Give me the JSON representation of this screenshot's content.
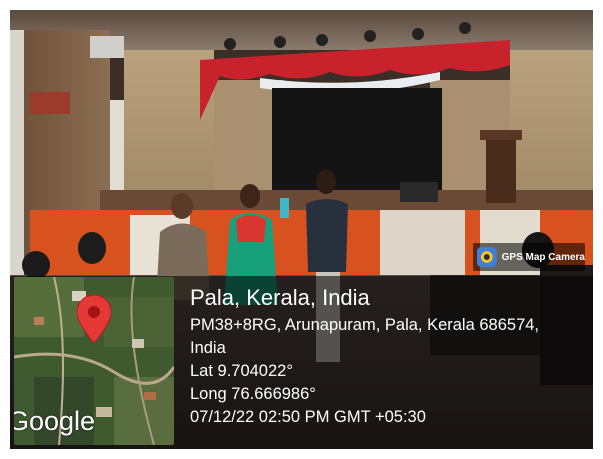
{
  "photo": {
    "description_icon": "photo-scene"
  },
  "badge": {
    "label": "GPS Map Camera",
    "icon": "gps-camera-icon"
  },
  "map": {
    "logo_text": "Google",
    "pin_icon": "map-pin-icon",
    "pin_color": "#e53935"
  },
  "info": {
    "title": "Pala, Kerala, India",
    "address_line1": "PM38+8RG, Arunapuram, Pala, Kerala 686574,",
    "address_line2": "India",
    "lat": "Lat 9.704022°",
    "long": "Long 76.666986°",
    "datetime": "07/12/22 02:50 PM GMT +05:30"
  },
  "colors": {
    "overlay": "#000000",
    "text": "#ffffff",
    "curtain_red": "#c8232c"
  }
}
